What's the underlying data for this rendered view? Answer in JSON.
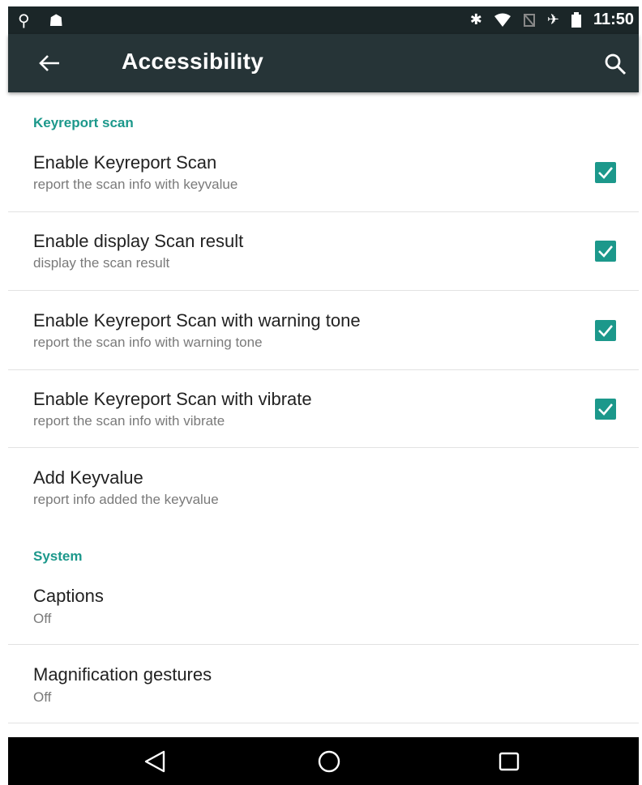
{
  "status_bar": {
    "time": "11:50",
    "left_icons": [
      "usb-icon",
      "android-debug-icon"
    ],
    "right_icons": [
      "bluetooth-icon",
      "wifi-icon",
      "no-sim-icon",
      "airplane-mode-icon",
      "battery-icon"
    ]
  },
  "toolbar": {
    "title": "Accessibility",
    "back_icon": "arrow-left-icon",
    "search_icon": "search-icon"
  },
  "sections": [
    {
      "header": "Keyreport scan",
      "items": [
        {
          "title": "Enable Keyreport Scan",
          "subtitle": "report the scan info with keyvalue",
          "checked": true
        },
        {
          "title": "Enable display Scan result",
          "subtitle": "display the scan result",
          "checked": true
        },
        {
          "title": "Enable Keyreport Scan with warning tone",
          "subtitle": "report the scan info with warning tone",
          "checked": true
        },
        {
          "title": "Enable Keyreport Scan with vibrate",
          "subtitle": "report the scan info with vibrate",
          "checked": true
        },
        {
          "title": "Add Keyvalue",
          "subtitle": "report info added the keyvalue"
        }
      ]
    },
    {
      "header": "System",
      "items": [
        {
          "title": "Captions",
          "subtitle": "Off"
        },
        {
          "title": "Magnification gestures",
          "subtitle": "Off"
        }
      ]
    }
  ],
  "nav_bar": {
    "icons": [
      "back-triangle-icon",
      "home-circle-icon",
      "recents-square-icon"
    ]
  },
  "colors": {
    "accent": "#1c988b",
    "toolbar": "#263437",
    "status_bar": "#1b2628"
  }
}
